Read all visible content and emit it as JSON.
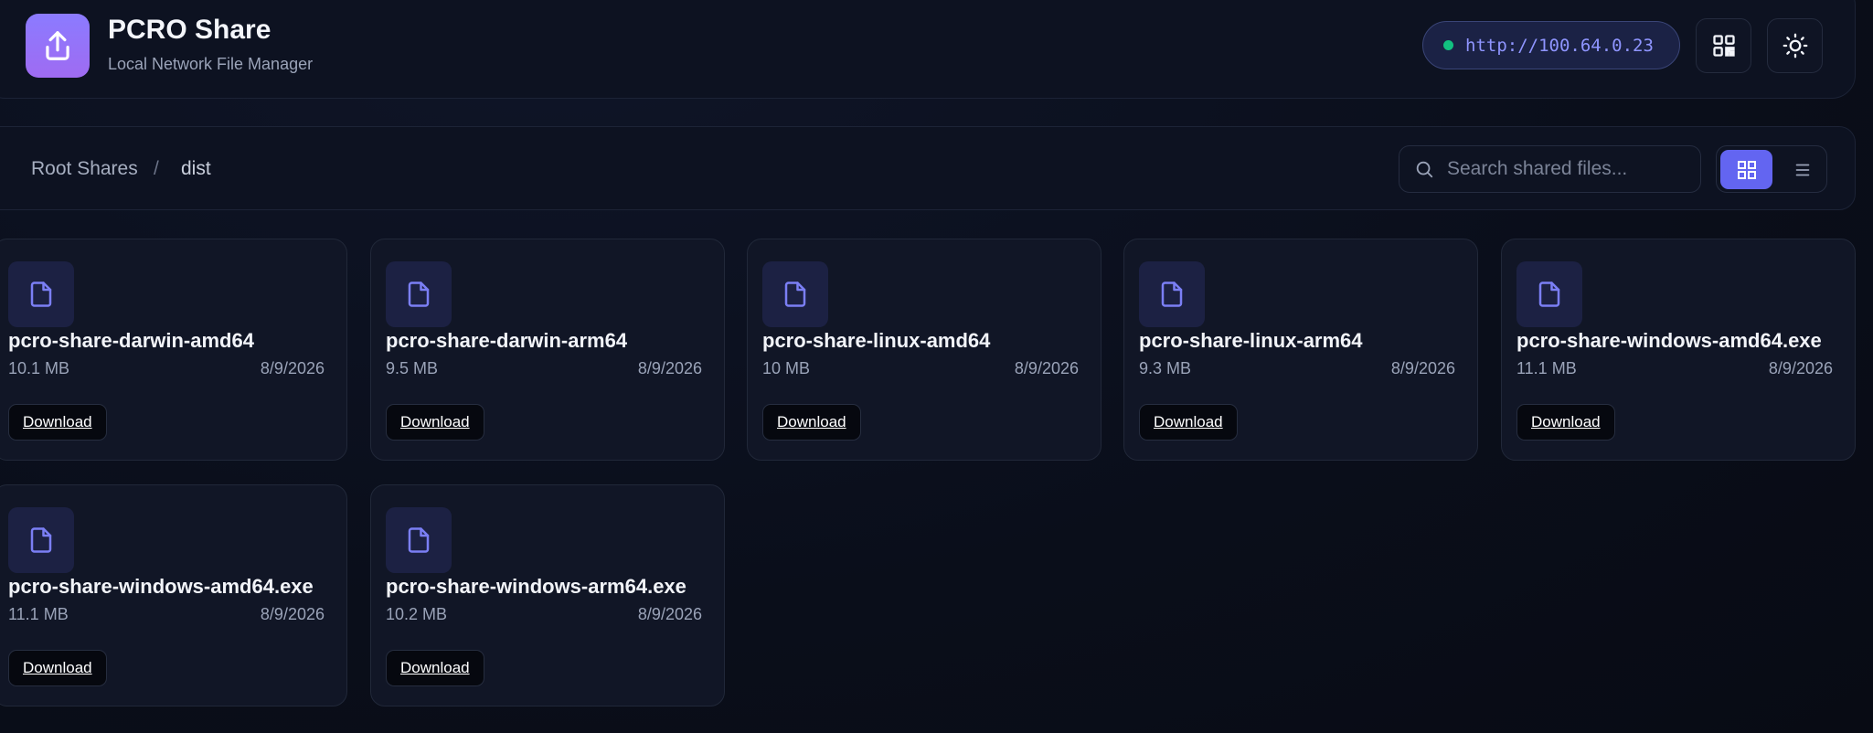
{
  "app": {
    "title": "PCRO Share",
    "subtitle": "Local Network File Manager",
    "logo_icon": "upload-share-icon",
    "accent_color": "#8b7bff"
  },
  "header": {
    "server_url": "http://100.64.0.23",
    "status": "online",
    "status_color": "#12c080",
    "qr_button_icon": "qr-code-icon",
    "theme_button_icon": "sun-icon"
  },
  "breadcrumb": {
    "items": [
      "Root Shares",
      "dist"
    ],
    "separator": "/"
  },
  "search": {
    "placeholder": "Search shared files...",
    "value": ""
  },
  "view_toggle": {
    "active": "grid",
    "options": [
      "grid-view-icon",
      "list-view-icon"
    ],
    "active_color": "#6365f1"
  },
  "files": [
    {
      "name": "pcro-share-darwin-amd64",
      "size": "10.1 MB",
      "date": "8/9/2026",
      "action": "Download"
    },
    {
      "name": "pcro-share-darwin-arm64",
      "size": "9.5 MB",
      "date": "8/9/2026",
      "action": "Download"
    },
    {
      "name": "pcro-share-linux-amd64",
      "size": "10 MB",
      "date": "8/9/2026",
      "action": "Download"
    },
    {
      "name": "pcro-share-linux-arm64",
      "size": "9.3 MB",
      "date": "8/9/2026",
      "action": "Download"
    },
    {
      "name": "pcro-share-windows-amd64.exe",
      "size": "11.1 MB",
      "date": "8/9/2026",
      "action": "Download"
    },
    {
      "name": "pcro-share-windows-amd64.exe",
      "size": "11.1 MB",
      "date": "8/9/2026",
      "action": "Download"
    },
    {
      "name": "pcro-share-windows-arm64.exe",
      "size": "10.2 MB",
      "date": "8/9/2026",
      "action": "Download"
    }
  ]
}
